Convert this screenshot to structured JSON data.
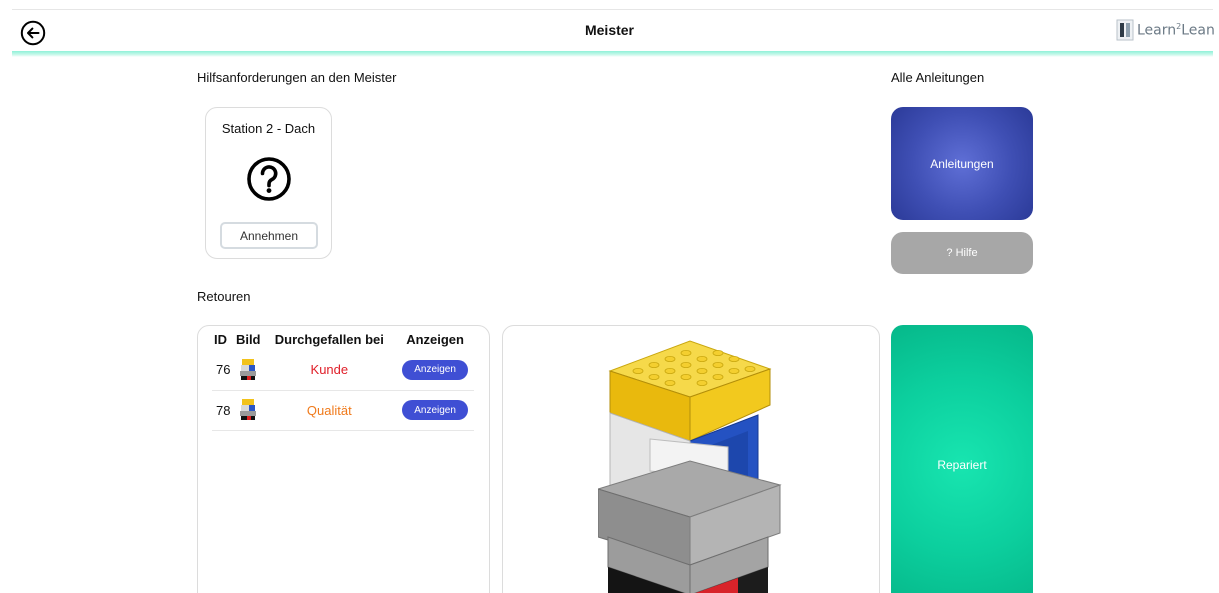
{
  "header": {
    "title": "Meister",
    "logo_text": "Learn",
    "logo_sup": "2",
    "logo_text_suffix": "Lean"
  },
  "help_requests": {
    "section_title": "Hilfsanforderungen an den Meister",
    "cards": [
      {
        "station": "Station 2 - Dach",
        "accept_label": "Annehmen"
      }
    ]
  },
  "all_instructions": {
    "section_title": "Alle Anleitungen",
    "instructions_label": "Anleitungen",
    "help_label": "? Hilfe"
  },
  "returns": {
    "section_title": "Retouren",
    "columns": [
      "ID",
      "Bild",
      "Durchgefallen bei",
      "Anzeigen"
    ],
    "rows": [
      {
        "id": "76",
        "failed_at": "Kunde",
        "show_label": "Anzeigen"
      },
      {
        "id": "78",
        "failed_at": "Qualität",
        "show_label": "Anzeigen"
      }
    ]
  },
  "actions": {
    "repaired_label": "Repariert"
  },
  "colors": {
    "accent_mint": "#8ff1d8",
    "primary_blue": "#3f4fd4",
    "repaired_green": "#0ccf9e",
    "fail_kunde": "#e0202a",
    "fail_qualitaet": "#f07a1b"
  },
  "icons": {
    "back": "back-arrow-circle-icon",
    "help": "question-circle-icon"
  }
}
